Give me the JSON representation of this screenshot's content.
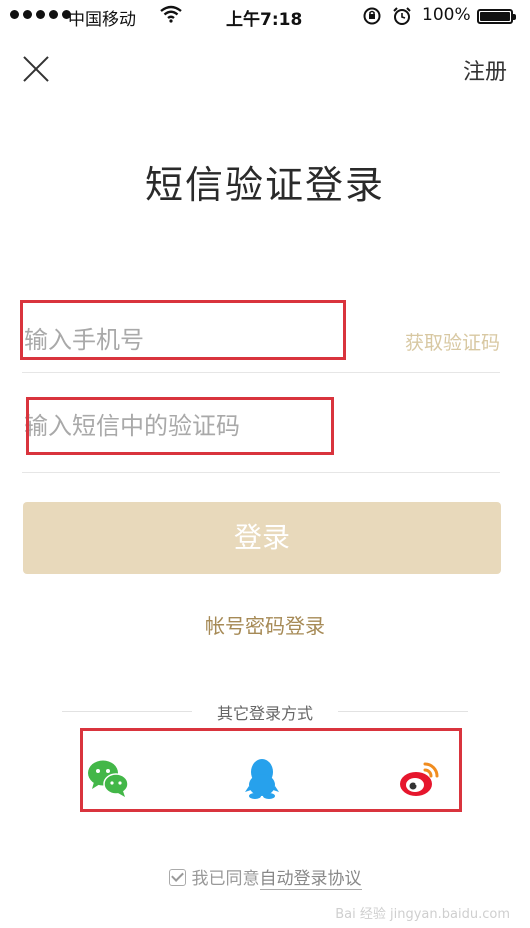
{
  "status_bar": {
    "carrier": "中国移动",
    "time": "上午7:18",
    "battery": "100%"
  },
  "header": {
    "close_icon": "close-icon",
    "register_label": "注册"
  },
  "title": "短信验证登录",
  "phone_field": {
    "placeholder": "输入手机号",
    "get_code_label": "获取验证码"
  },
  "code_field": {
    "placeholder": "输入短信中的验证码"
  },
  "login_button": "登录",
  "password_login_link": "帐号密码登录",
  "other_login": {
    "label": "其它登录方式",
    "icons": [
      "wechat-icon",
      "qq-icon",
      "weibo-icon"
    ]
  },
  "agreement": {
    "prefix": "我已同意",
    "link": "自动登录协议",
    "checked": true
  },
  "watermark": "Bai 经验 jingyan.baidu.com",
  "colors": {
    "accent": "#a68a56",
    "button_bg": "#e8d9bb",
    "get_code": "#d8c8a2",
    "annotation_red": "#d9343d",
    "wechat": "#43b748",
    "qq": "#27a1ec",
    "weibo": "#e6162d"
  }
}
